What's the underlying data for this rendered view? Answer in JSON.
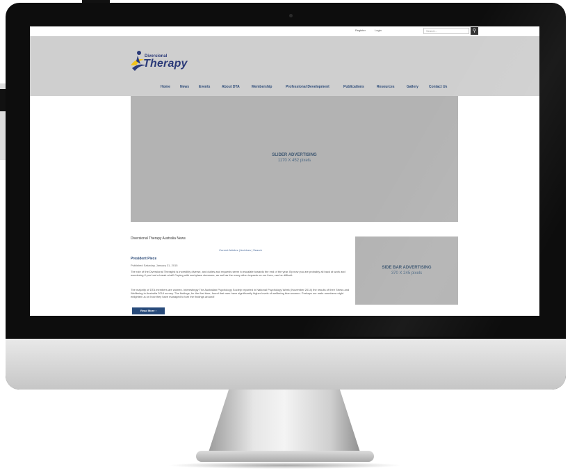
{
  "site": {
    "topbar": {
      "register_label": "Register",
      "login_label": "Login",
      "search_placeholder": "Search..."
    },
    "logo": {
      "line1": "Diversional",
      "line2": "Therapy"
    },
    "nav": [
      "Home",
      "News",
      "Events",
      "About DTA",
      "Membership",
      "Professional Development",
      "Publications",
      "Resources",
      "Gallery",
      "Contact Us"
    ],
    "slider": {
      "title": "SLIDER ADVERTISING",
      "subtitle": "1170 X 452 pixels"
    },
    "news": {
      "section_title": "Diversional Therapy Australia News",
      "links": "Current Articles | Archives | Search",
      "post_title": "President Piece",
      "post_date": "Published Saturday, January 31, 2015",
      "para1": "The role of the Diversional Therapist is incredibly diverse, and duties and requests seem to escalate towards the end of the year. By now you are probably all back at work and wondering if you had a break at all! Coping with workplace stressors, as well as the many other impacts on our lives, can be difficult.",
      "para2": "The majority of DTA members are women. Interestingly The Australian Psychology Society reported in National Psychology Week (November 2014) the results of their Stress and Wellbeing in Australia 2014 survey. The findings, for the first time, found that men have significantly higher levels of wellbeing than women. Perhaps our male members might enlighten us on how they have managed to turn the findings around!",
      "read_more": "Read More  ›"
    },
    "sidebar_ad": {
      "title": "SIDE BAR ADVERTISING",
      "subtitle": "370 X 245 pixels"
    }
  },
  "colors": {
    "brand_blue": "#2b4a78",
    "header_gray": "#cfcfcf",
    "ad_gray": "#b3b3b3"
  },
  "icons": [
    "search-icon"
  ]
}
